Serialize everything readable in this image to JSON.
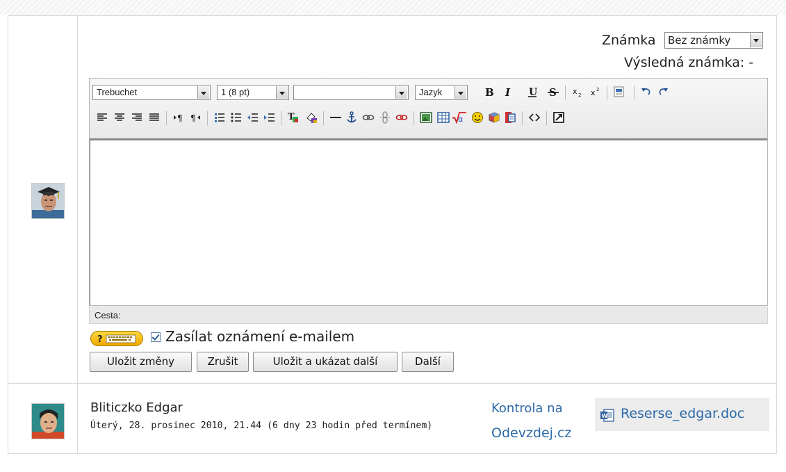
{
  "grade": {
    "label": "Známka",
    "selected": "Bez známky",
    "final_label": "Výsledná známka: -"
  },
  "editor": {
    "font_family": "Trebuchet",
    "font_size": "1 (8 pt)",
    "style": "",
    "language": "Jazyk",
    "path_label": "Cesta:"
  },
  "notify": {
    "checked": true,
    "label": "Zasílat oznámení e-mailem"
  },
  "buttons": {
    "save": "Uložit změny",
    "cancel": "Zrušit",
    "save_next": "Uložit a ukázat další",
    "next": "Další"
  },
  "submission": {
    "student_name": "Bliticzko Edgar",
    "submitted_text": "Úterý, 28. prosinec 2010, 21.44 (6 dny 23 hodin před termínem)",
    "check_link_line1": "Kontrola na",
    "check_link_line2": "Odevzdej.cz",
    "file_name": "Reserse_edgar.doc"
  },
  "icons": {
    "toolbar": [
      "bold-icon",
      "italic-icon",
      "underline-icon",
      "strikethrough-icon",
      "subscript-icon",
      "superscript-icon",
      "paste-word-icon",
      "undo-icon",
      "redo-icon",
      "align-left-icon",
      "align-center-icon",
      "align-right-icon",
      "justify-icon",
      "ltr-icon",
      "rtl-icon",
      "ordered-list-icon",
      "unordered-list-icon",
      "outdent-icon",
      "indent-icon",
      "text-color-icon",
      "background-color-icon",
      "horizontal-rule-icon",
      "anchor-icon",
      "link-icon",
      "unlink-icon",
      "nolink-icon",
      "image-icon",
      "table-icon",
      "math-icon",
      "smiley-icon",
      "package-icon",
      "search-replace-icon",
      "html-source-icon",
      "fullscreen-icon"
    ]
  }
}
